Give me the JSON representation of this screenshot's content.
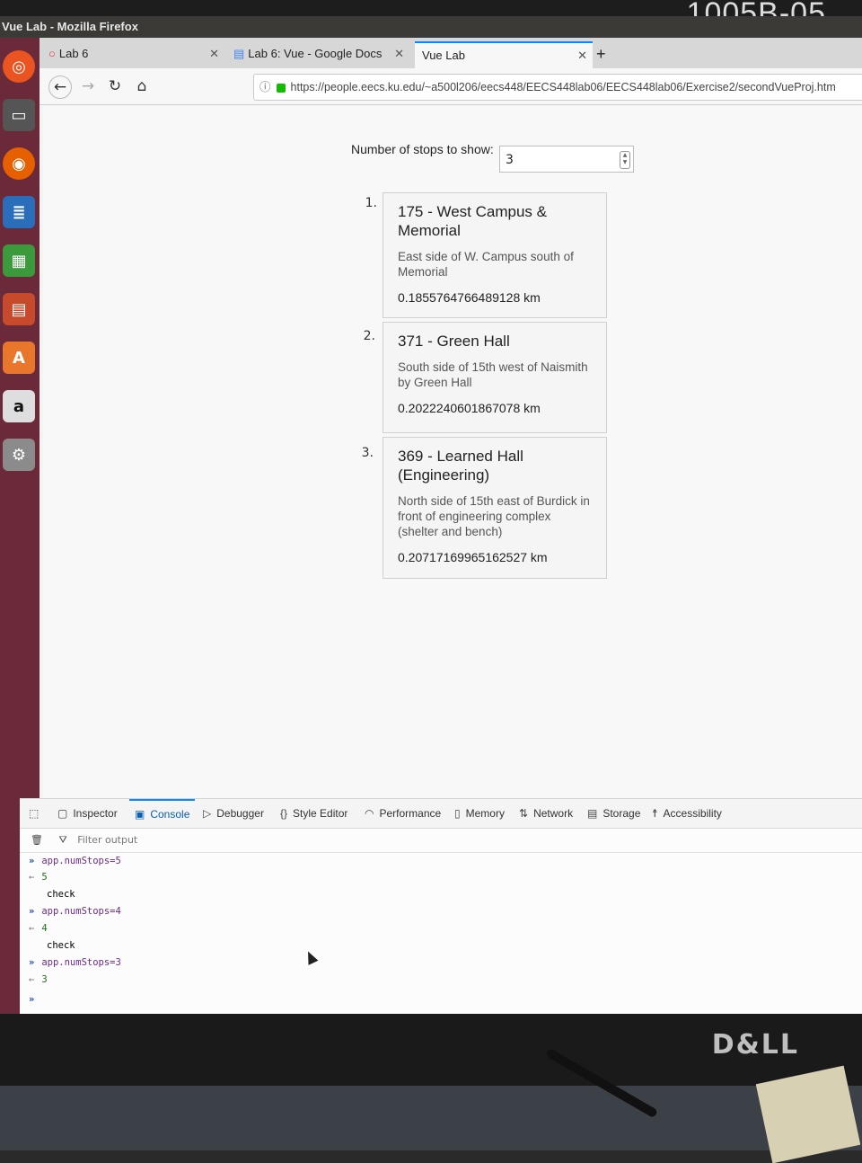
{
  "monitor": {
    "sticker": "1005B-05",
    "brand": "D&LL"
  },
  "window": {
    "title": "Vue Lab - Mozilla Firefox"
  },
  "tabs": [
    {
      "label": "Lab 6"
    },
    {
      "label": "Lab 6: Vue - Google Docs"
    },
    {
      "label": "Vue Lab"
    }
  ],
  "url": "https://people.eecs.ku.edu/~a500l206/eecs448/EECS448lab06/EECS448lab06/Exercise2/secondVueProj.htm",
  "controls": {
    "stops_label": "Number of stops to show:",
    "stops_value": "3"
  },
  "stops": [
    {
      "num": "1.",
      "name": "175 - West Campus & Memorial",
      "desc": "East side of W. Campus south of Memorial",
      "dist": "0.1855764766489128 km"
    },
    {
      "num": "2.",
      "name": "371 - Green Hall",
      "desc": "South side of 15th west of Naismith by Green Hall",
      "dist": "0.2022240601867078 km"
    },
    {
      "num": "3.",
      "name": "369 - Learned Hall (Engineering)",
      "desc": "North side of 15th east of Burdick in front of engineering complex (shelter and bench)",
      "dist": "0.20717169965162527 km"
    }
  ],
  "devtools": {
    "tabs": [
      "Inspector",
      "Console",
      "Debugger",
      "Style Editor",
      "Performance",
      "Memory",
      "Network",
      "Storage",
      "Accessibility"
    ],
    "filter_placeholder": "Filter output",
    "console": [
      {
        "kind": "in",
        "text": "app.numStops=5"
      },
      {
        "kind": "out",
        "text": "5"
      },
      {
        "kind": "log",
        "text": "check"
      },
      {
        "kind": "in",
        "text": "app.numStops=4"
      },
      {
        "kind": "out",
        "text": "4"
      },
      {
        "kind": "log",
        "text": "check"
      },
      {
        "kind": "in",
        "text": "app.numStops=3"
      },
      {
        "kind": "out",
        "text": "3"
      }
    ]
  }
}
